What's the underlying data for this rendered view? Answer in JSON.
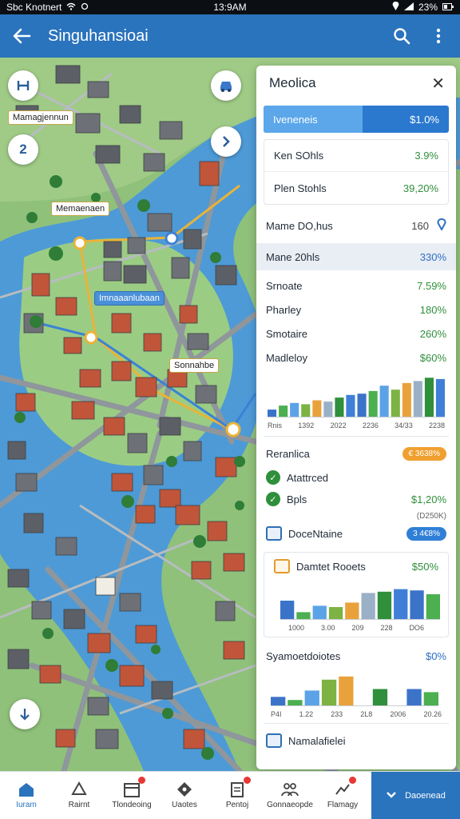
{
  "status_bar": {
    "left": "Sbc Knotnert",
    "time": "13:9AM",
    "battery": "23%"
  },
  "app_bar": {
    "title": "Singuhansioai"
  },
  "map": {
    "labels": {
      "top_left": "Mamagjennun",
      "center": "Memaenaen",
      "blue_tag": "Imnaaanlubaan",
      "bottom": "Sonnahbe"
    },
    "fab_number": "2"
  },
  "panel": {
    "title": "Meolica",
    "highlight": {
      "label": "Iveneneis",
      "value": "$1.0%"
    },
    "card1": [
      {
        "label": "Ken SOhls",
        "value": "3.9%"
      },
      {
        "label": "Plen Stohls",
        "value": "39,20%"
      }
    ],
    "header_row": {
      "label": "Mame DO,hus",
      "value": "160"
    },
    "selected_row": {
      "label": "Mane 20hls",
      "value": "330%"
    },
    "stats": [
      {
        "label": "Srnoate",
        "value": "7.59%"
      },
      {
        "label": "Pharley",
        "value": "180%"
      },
      {
        "label": "Smotaire",
        "value": "260%"
      },
      {
        "label": "Madleloy",
        "value": "$60%"
      }
    ],
    "chart1_ticks": [
      "Rnis",
      "1392",
      "2022",
      "2236",
      "34/33",
      "2238"
    ],
    "section2": {
      "title": "Reranlica",
      "badge": "€ 3638%",
      "items": [
        {
          "label": "Atattrced",
          "value": ""
        },
        {
          "label": "Bpls",
          "value": "$1,20%",
          "sub": "(D250K)"
        }
      ],
      "doc_label": "DoceNtaine",
      "doc_badge": "3 4€8%"
    },
    "card3": {
      "title": "Damtet Rooets",
      "value": "$50%",
      "ticks": [
        "1000",
        "3.00",
        "209",
        "228",
        "DO6"
      ]
    },
    "card4": {
      "title": "Syamoetdoiotes",
      "value": "$0%",
      "ticks": [
        "P4I",
        "1.22",
        "233",
        "2L8",
        "2006",
        "20.26"
      ]
    },
    "footer_label": "Namalafielei"
  },
  "bottom_nav": {
    "items": [
      {
        "label": "Iuram",
        "icon": "home-icon",
        "badge": false
      },
      {
        "label": "Rairnt",
        "icon": "recycle-icon",
        "badge": false
      },
      {
        "label": "Tlondeoing",
        "icon": "calendar-icon",
        "badge": true
      },
      {
        "label": "Uaotes",
        "icon": "tag-icon",
        "badge": false
      },
      {
        "label": "Pentoj",
        "icon": "clipboard-icon",
        "badge": true
      },
      {
        "label": "Gonnaeopde",
        "icon": "people-icon",
        "badge": false
      },
      {
        "label": "Flamagy",
        "icon": "chart-icon",
        "badge": true
      }
    ],
    "cta_label": "Daoenead"
  },
  "colors": {
    "brand": "#2a73bd",
    "positive": "#2f8f3b",
    "water": "#4d9ad6",
    "land": "#8fc17a"
  },
  "chart_data": [
    {
      "type": "bar",
      "categories": [
        "Rnis",
        "1392",
        "2022",
        "2236",
        "34/33",
        "2238"
      ],
      "series": [
        {
          "values": [
            12,
            18,
            22,
            20,
            26,
            24,
            30,
            34,
            36,
            40,
            48,
            42,
            52,
            55,
            60,
            58
          ]
        }
      ],
      "ylim": [
        0,
        70
      ]
    },
    {
      "type": "bar",
      "title": "Damtet Rooets",
      "categories": [
        "1000",
        "3.00",
        "209",
        "228",
        "DO6"
      ],
      "series": [
        {
          "values": [
            30,
            12,
            22,
            20,
            27,
            42,
            44,
            48,
            46,
            40
          ]
        }
      ],
      "ylim": [
        0,
        60
      ]
    },
    {
      "type": "bar",
      "title": "Syamoetdoiotes",
      "categories": [
        "P4I",
        "1.22",
        "233",
        "2L8",
        "2006",
        "20.26"
      ],
      "series": [
        {
          "values": [
            12,
            8,
            20,
            34,
            38,
            0,
            22,
            0,
            22,
            18
          ]
        }
      ],
      "ylim": [
        0,
        45
      ]
    }
  ]
}
